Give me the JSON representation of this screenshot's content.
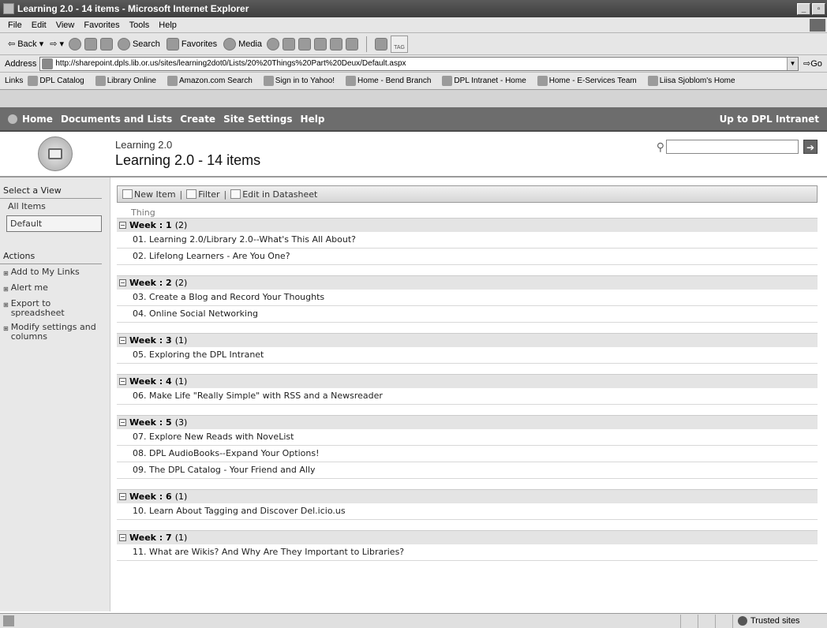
{
  "window": {
    "title": "Learning 2.0 - 14 items - Microsoft Internet Explorer"
  },
  "menu": [
    "File",
    "Edit",
    "View",
    "Favorites",
    "Tools",
    "Help"
  ],
  "toolbar": {
    "back": "Back",
    "search": "Search",
    "favorites": "Favorites",
    "media": "Media",
    "tag": "TAG"
  },
  "address": {
    "label": "Address",
    "url": "http://sharepoint.dpls.lib.or.us/sites/learning2dot0/Lists/20%20Things%20Part%20Deux/Default.aspx",
    "go": "Go"
  },
  "links": {
    "label": "Links",
    "items": [
      "DPL Catalog",
      "Library Online",
      "Amazon.com Search",
      "Sign in to Yahoo!",
      "Home - Bend Branch",
      "DPL Intranet - Home",
      "Home - E-Services Team",
      "Liisa Sjoblom's Home"
    ]
  },
  "sp_nav": {
    "items": [
      "Home",
      "Documents and Lists",
      "Create",
      "Site Settings",
      "Help"
    ],
    "right": "Up to DPL Intranet"
  },
  "header": {
    "site_name": "Learning 2.0",
    "page_title": "Learning 2.0 - 14 items"
  },
  "leftnav": {
    "view_heading": "Select a View",
    "views": [
      "All Items",
      "Default"
    ],
    "actions_heading": "Actions",
    "actions": [
      "Add to My Links",
      "Alert me",
      "Export to spreadsheet",
      "Modify settings and columns"
    ]
  },
  "list_toolbar": {
    "new_item": "New Item",
    "filter": "Filter",
    "edit_datasheet": "Edit in Datasheet"
  },
  "column_header": "Thing",
  "groups": [
    {
      "label": "Week : 1",
      "count": "(2)",
      "items": [
        "01. Learning 2.0/Library 2.0--What's This All About?",
        "02. Lifelong Learners - Are You One?"
      ]
    },
    {
      "label": "Week : 2",
      "count": "(2)",
      "items": [
        "03. Create a Blog and Record Your Thoughts",
        "04. Online Social Networking"
      ]
    },
    {
      "label": "Week : 3",
      "count": "(1)",
      "items": [
        "05. Exploring the DPL Intranet"
      ]
    },
    {
      "label": "Week : 4",
      "count": "(1)",
      "items": [
        "06. Make Life \"Really Simple\" with RSS and a Newsreader"
      ]
    },
    {
      "label": "Week : 5",
      "count": "(3)",
      "items": [
        "07. Explore New Reads with NoveList",
        "08. DPL AudioBooks--Expand Your Options!",
        "09. The DPL Catalog - Your Friend and Ally"
      ]
    },
    {
      "label": "Week : 6",
      "count": "(1)",
      "items": [
        "10. Learn About Tagging and Discover Del.icio.us"
      ]
    },
    {
      "label": "Week : 7",
      "count": "(1)",
      "items": [
        "11. What are Wikis? And Why Are They Important to Libraries?"
      ]
    }
  ],
  "status": {
    "zone": "Trusted sites"
  }
}
